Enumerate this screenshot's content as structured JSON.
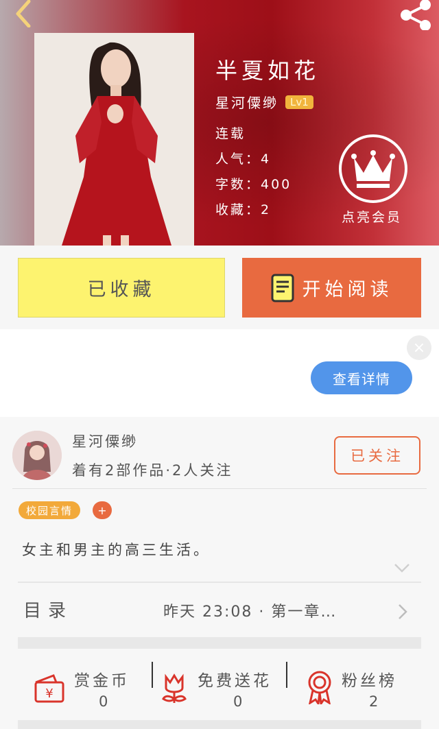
{
  "header": {
    "back_icon": "chevron-left-icon",
    "share_icon": "share-icon"
  },
  "book": {
    "title": "半夏如花",
    "author": "星河僳缈",
    "level": "Lv1",
    "status": "连载",
    "popularity": "人气：4",
    "word_count": "字数：400",
    "favorites": "收藏：2"
  },
  "vip": {
    "icon": "crown-icon",
    "label": "点亮会员"
  },
  "actions": {
    "collected_label": "已收藏",
    "read_label": "开始阅读",
    "read_icon": "book-icon"
  },
  "ad": {
    "close_glyph": "×",
    "detail_label": "查看详情"
  },
  "author_card": {
    "name": "星河僳缈",
    "stats": "着有2部作品·2人关注",
    "follow_label": "已关注"
  },
  "tags": {
    "items": [
      "校园言情"
    ],
    "add_glyph": "+"
  },
  "synopsis": "女主和男主的高三生活。",
  "toc": {
    "label": "目录",
    "latest": "昨天 23:08 · 第一章…"
  },
  "stats": [
    {
      "label": "赏金币",
      "value": "0",
      "icon": "reward-coin-icon"
    },
    {
      "label": "免费送花",
      "value": "0",
      "icon": "flower-icon"
    },
    {
      "label": "粉丝榜",
      "value": "2",
      "icon": "ribbon-medal-icon"
    }
  ],
  "colors": {
    "accent": "#e86a40",
    "collected_bg": "#fdf36f",
    "tag_bg": "#f2a93a",
    "detail_button": "#5295ea",
    "header_red": "#a8141f"
  }
}
